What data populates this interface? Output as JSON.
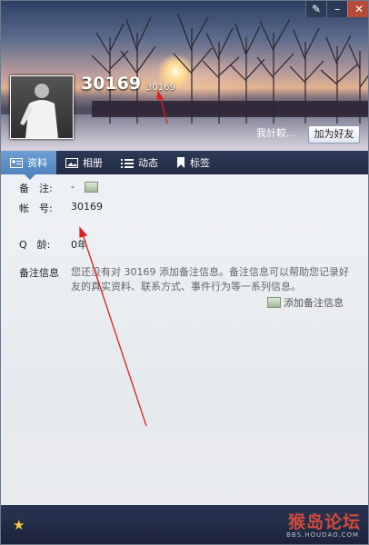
{
  "header": {
    "nickname": "30169",
    "id_small": "30169",
    "compare_label": "我計較...",
    "add_friend": "加为好友"
  },
  "tabs": [
    {
      "label": "资料",
      "icon": "card-icon"
    },
    {
      "label": "相册",
      "icon": "photo-icon"
    },
    {
      "label": "动态",
      "icon": "list-icon"
    },
    {
      "label": "标签",
      "icon": "bookmark-icon"
    }
  ],
  "info": {
    "note_label": "备　注:",
    "note_value": "-",
    "account_label": "帐　号:",
    "account_value": "30169",
    "age_label": "Q　龄:",
    "age_value": "0年",
    "memo_label": "备注信息",
    "memo_desc": "您还没有对 30169 添加备注信息。备注信息可以帮助您记录好友的真实资料、联系方式、事件行为等一系列信息。",
    "add_memo": "添加备注信息"
  },
  "footer": {
    "watermark": "猴岛论坛",
    "watermark_sub": "BBS.HOUDAO.COM"
  },
  "colors": {
    "tab_active": "#4f83bd",
    "annotation_arrow": "#e02020"
  }
}
